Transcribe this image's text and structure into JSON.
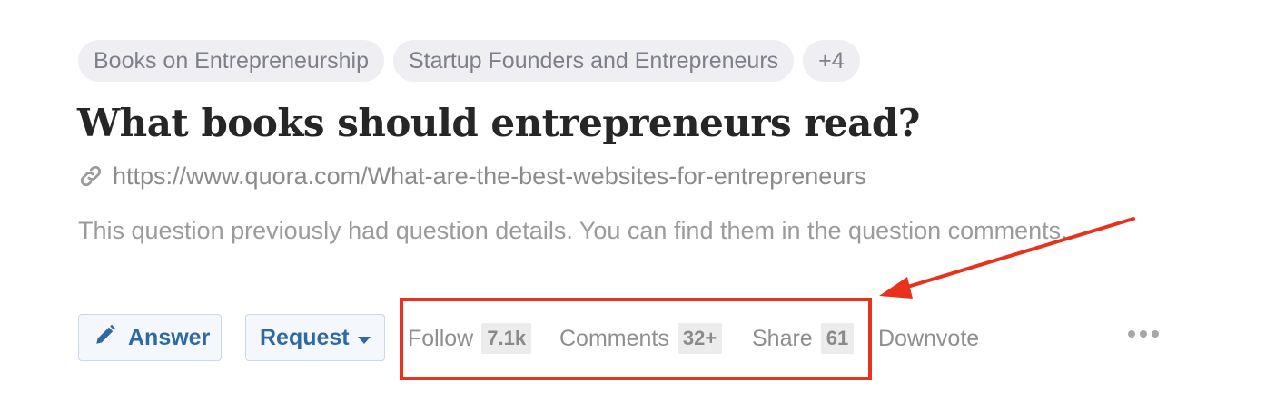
{
  "topics": [
    {
      "label": "Books on Entrepreneurship"
    },
    {
      "label": "Startup Founders and Entrepreneurs"
    },
    {
      "label": "+4"
    }
  ],
  "question": {
    "title": "What books should entrepreneurs read?",
    "url": "https://www.quora.com/What-are-the-best-websites-for-entrepreneurs",
    "details": "This question previously had question details. You can find them in the question comments."
  },
  "actions": {
    "answer_label": "Answer",
    "request_label": "Request",
    "follow_label": "Follow",
    "follow_count": "7.1k",
    "comments_label": "Comments",
    "comments_count": "32+",
    "share_label": "Share",
    "share_count": "61",
    "downvote_label": "Downvote"
  },
  "icons": {
    "link": "link-icon",
    "answer": "pencil-icon",
    "request": "caret-down-icon",
    "more": "ellipsis-icon"
  },
  "colors": {
    "accent_blue": "#2e69a3",
    "annotation_red": "#e8321e",
    "pill_bg": "#eeeef3",
    "muted_text": "#8f8f8f"
  }
}
